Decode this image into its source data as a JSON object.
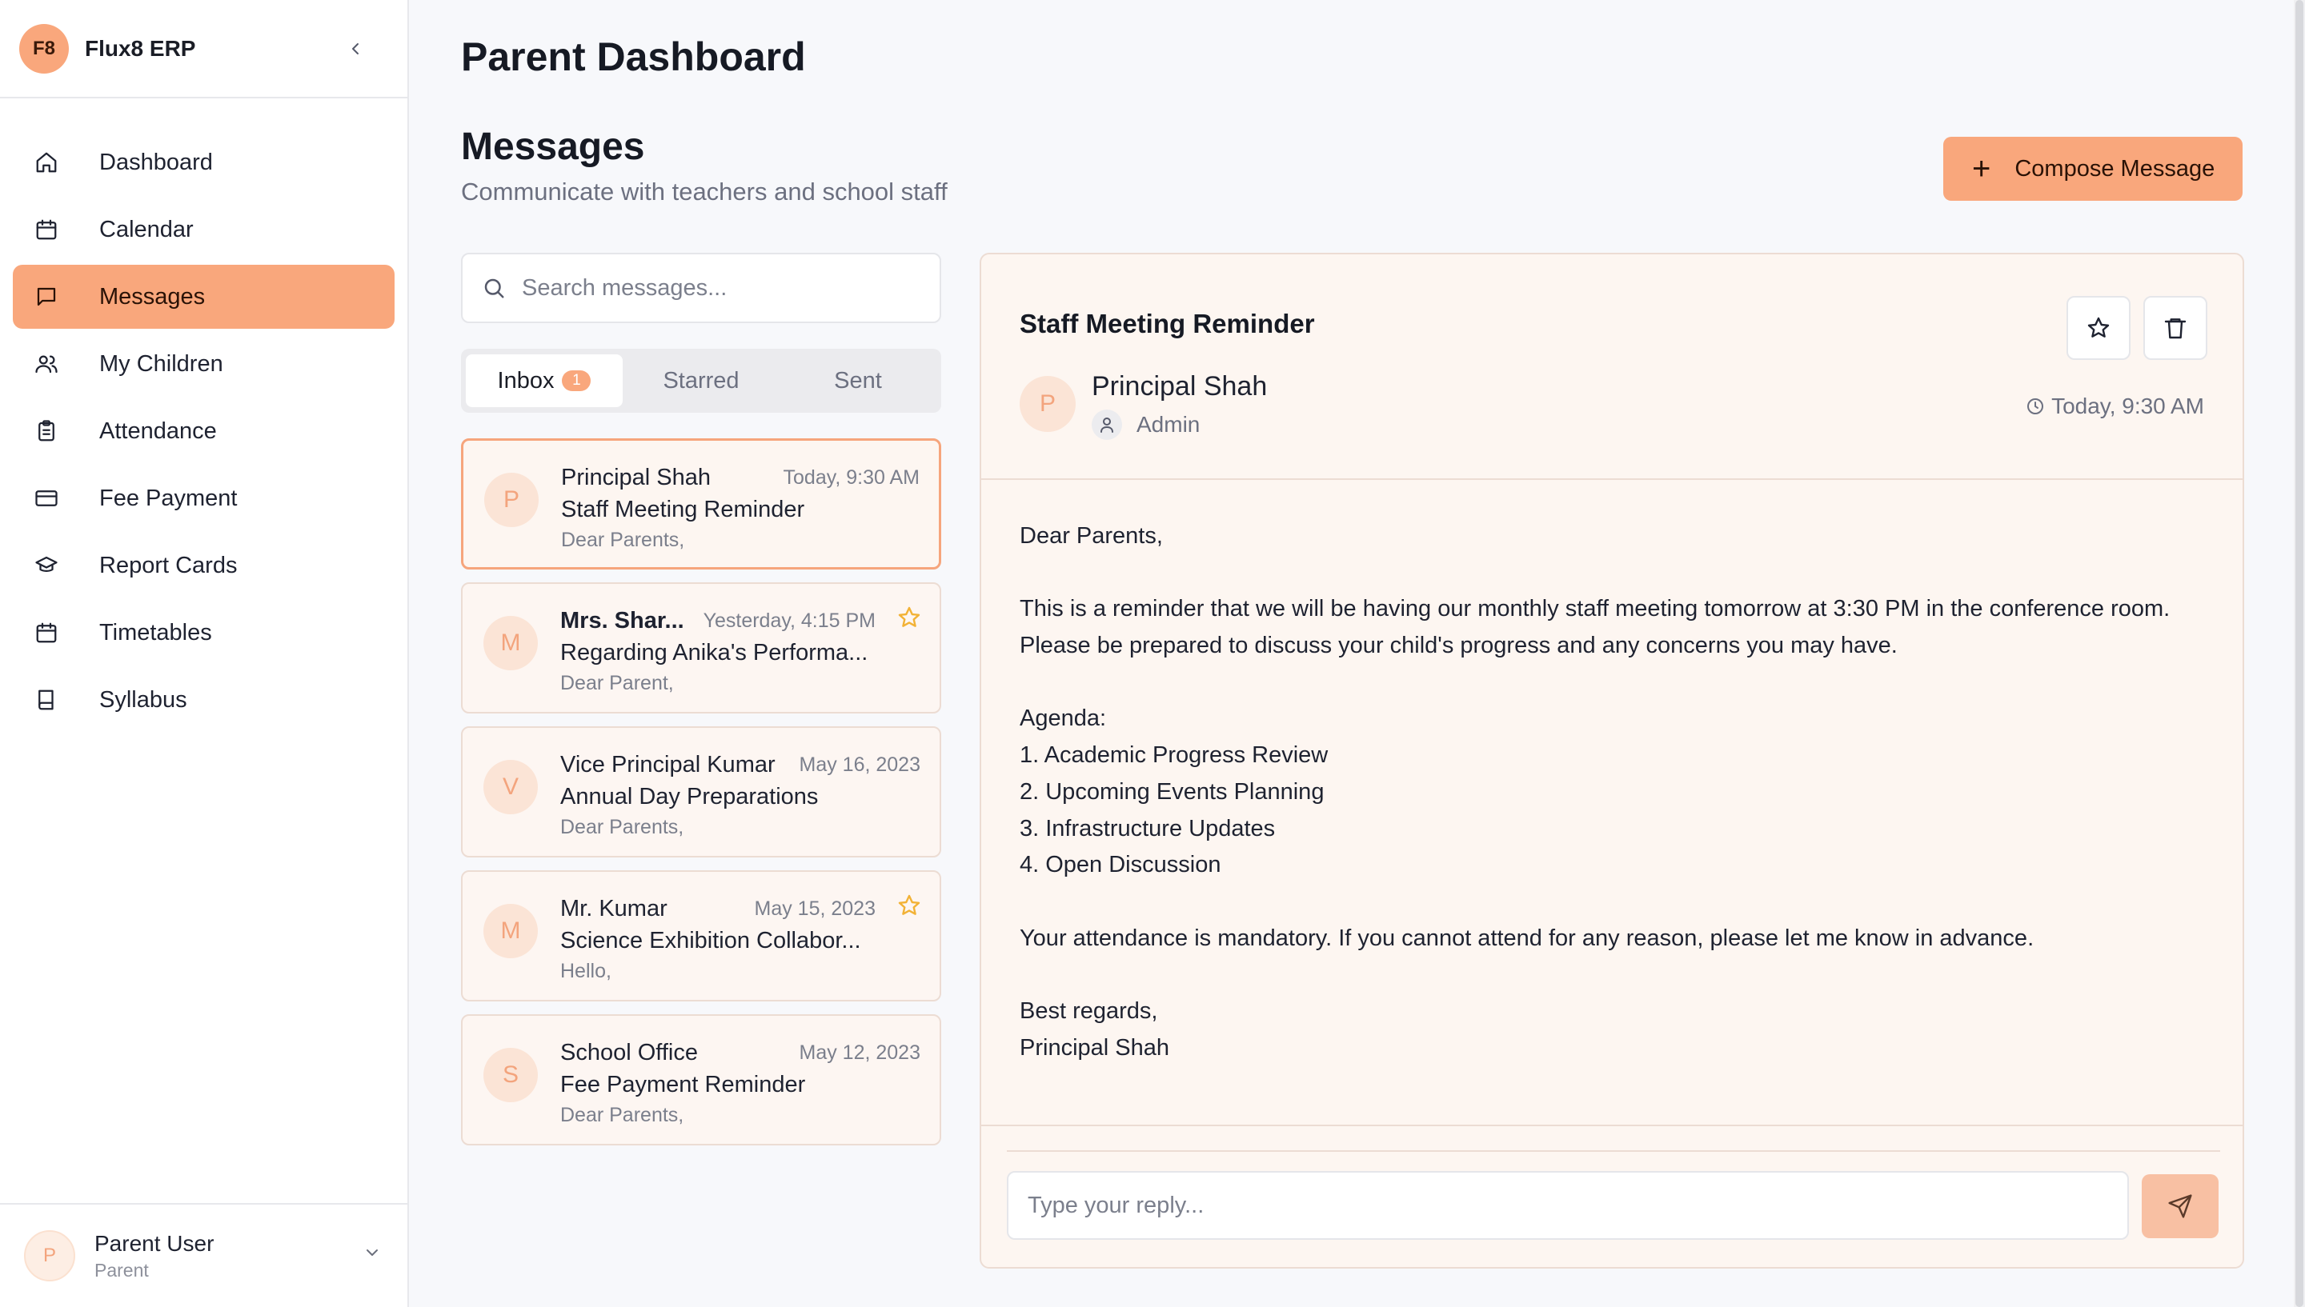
{
  "app": {
    "logo_text": "F8",
    "name": "Flux8 ERP"
  },
  "sidebar": {
    "items": [
      {
        "label": "Dashboard",
        "icon": "home-icon"
      },
      {
        "label": "Calendar",
        "icon": "calendar-icon"
      },
      {
        "label": "Messages",
        "icon": "message-icon",
        "active": true
      },
      {
        "label": "My Children",
        "icon": "users-icon"
      },
      {
        "label": "Attendance",
        "icon": "clipboard-icon"
      },
      {
        "label": "Fee Payment",
        "icon": "credit-card-icon"
      },
      {
        "label": "Report Cards",
        "icon": "graduation-cap-icon"
      },
      {
        "label": "Timetables",
        "icon": "calendar-icon"
      },
      {
        "label": "Syllabus",
        "icon": "book-icon"
      }
    ],
    "user": {
      "initial": "P",
      "name": "Parent User",
      "role": "Parent"
    }
  },
  "page": {
    "title": "Parent Dashboard",
    "section_title": "Messages",
    "section_subtitle": "Communicate with teachers and school staff",
    "compose_label": "Compose Message"
  },
  "search": {
    "placeholder": "Search messages..."
  },
  "tabs": [
    {
      "label": "Inbox",
      "badge": "1",
      "active": true
    },
    {
      "label": "Starred"
    },
    {
      "label": "Sent"
    }
  ],
  "messages": [
    {
      "initial": "P",
      "sender": "Principal Shah",
      "date": "Today, 9:30 AM",
      "subject": "Staff Meeting Reminder",
      "preview": "Dear Parents,",
      "selected": true,
      "unread": false,
      "starred": false
    },
    {
      "initial": "M",
      "sender": "Mrs. Shar...",
      "date": "Yesterday, 4:15 PM",
      "subject": "Regarding Anika's Performa...",
      "preview": "Dear Parent,",
      "selected": false,
      "unread": true,
      "starred": true
    },
    {
      "initial": "V",
      "sender": "Vice Principal Kumar",
      "date": "May 16, 2023",
      "subject": "Annual Day Preparations",
      "preview": "Dear Parents,",
      "selected": false,
      "unread": false,
      "starred": false
    },
    {
      "initial": "M",
      "sender": "Mr. Kumar",
      "date": "May 15, 2023",
      "subject": "Science Exhibition Collabor...",
      "preview": "Hello,",
      "selected": false,
      "unread": false,
      "starred": true
    },
    {
      "initial": "S",
      "sender": "School Office",
      "date": "May 12, 2023",
      "subject": "Fee Payment Reminder",
      "preview": "Dear Parents,",
      "selected": false,
      "unread": false,
      "starred": false
    }
  ],
  "detail": {
    "subject": "Staff Meeting Reminder",
    "initial": "P",
    "sender": "Principal Shah",
    "role": "Admin",
    "time": "Today, 9:30 AM",
    "body": [
      "Dear Parents,",
      "This is a reminder that we will be having our monthly staff meeting tomorrow at 3:30 PM in the conference room.\nPlease be prepared to discuss your child's progress and any concerns you may have.",
      "Agenda:\n1. Academic Progress Review\n2. Upcoming Events Planning\n3. Infrastructure Updates\n4. Open Discussion",
      "Your attendance is mandatory. If you cannot attend for any reason, please let me know in advance.",
      "Best regards,\nPrincipal Shah"
    ],
    "reply_placeholder": "Type your reply..."
  },
  "colors": {
    "accent": "#f9a77c",
    "star": "#f2b236",
    "card_bg": "#fdf6f1"
  }
}
